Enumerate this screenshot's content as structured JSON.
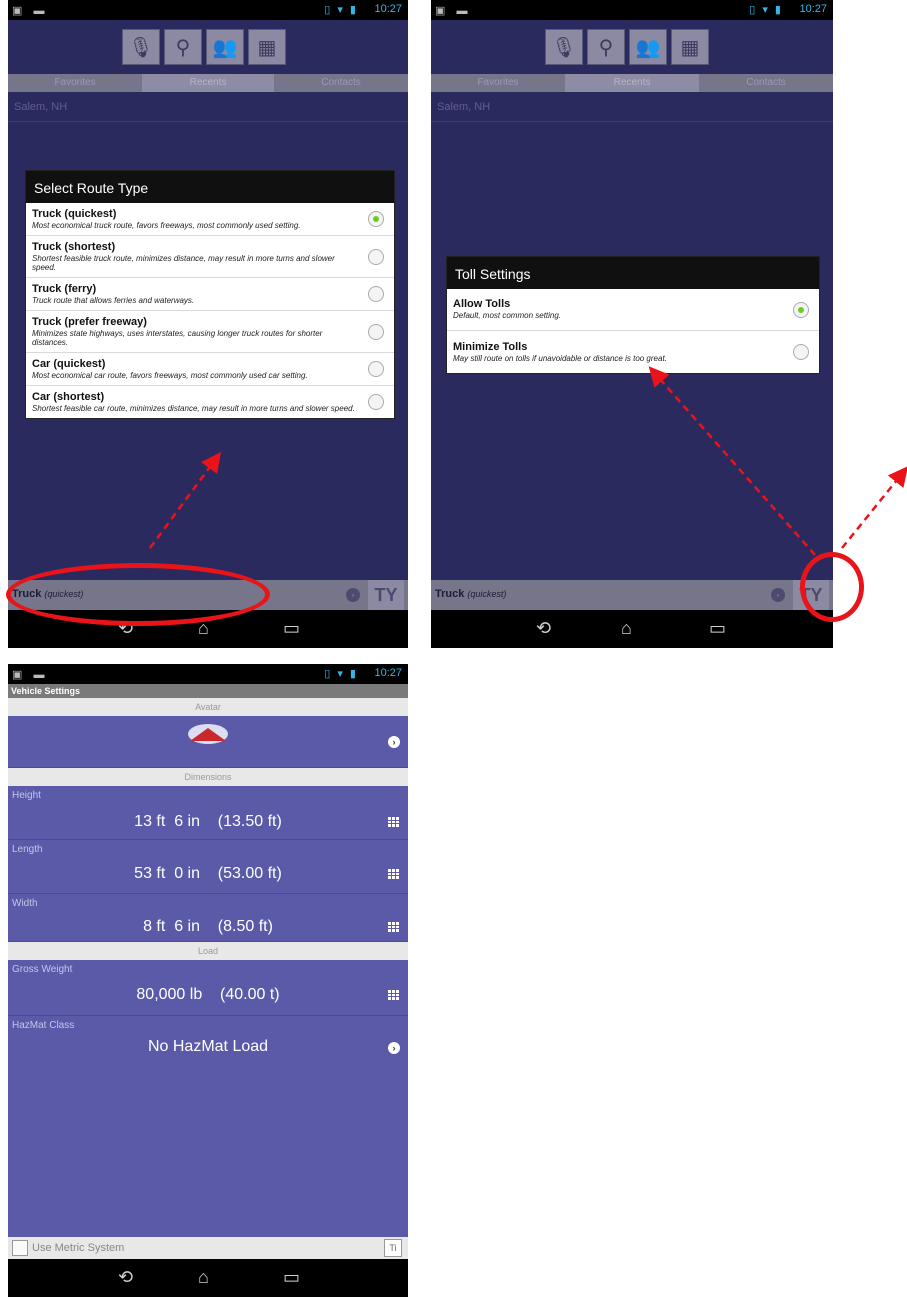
{
  "status_bar": {
    "time": "10:27",
    "left_icons": "▣ ▬",
    "signal": "▯ ▾ ▮"
  },
  "toolbar_icons": [
    "microphone-icon",
    "search-icon",
    "contacts-icon",
    "map-icon"
  ],
  "tabs": [
    "Favorites",
    "Recents",
    "Contacts"
  ],
  "recent_item": "Salem, NH",
  "bottom_bar": {
    "vehicle": "Truck",
    "mode": "(quickest)",
    "dropdown": "◦",
    "wrench": "TY"
  },
  "route_dialog": {
    "title": "Select Route Type",
    "items": [
      {
        "title": "Truck (quickest)",
        "desc": "Most economical truck route, favors freeways, most commonly used setting.",
        "selected": true
      },
      {
        "title": "Truck (shortest)",
        "desc": "Shortest feasible truck route, minimizes distance, may result in more turns and slower speed.",
        "selected": false
      },
      {
        "title": "Truck (ferry)",
        "desc": "Truck route that allows ferries and waterways.",
        "selected": false
      },
      {
        "title": "Truck (prefer freeway)",
        "desc": "Minimizes state highways, uses interstates, causing longer truck routes for shorter distances.",
        "selected": false
      },
      {
        "title": "Car (quickest)",
        "desc": "Most economical car route, favors freeways, most commonly used car setting.",
        "selected": false
      },
      {
        "title": "Car (shortest)",
        "desc": "Shortest feasible car route, minimizes distance, may result in more turns and slower speed.",
        "selected": false
      }
    ]
  },
  "toll_dialog": {
    "title": "Toll Settings",
    "items": [
      {
        "title": "Allow Tolls",
        "desc": "Default, most common setting.",
        "selected": true
      },
      {
        "title": "Minimize Tolls",
        "desc": "May still route on tolls if unavoidable or distance is too great.",
        "selected": false
      }
    ]
  },
  "nav_icons": [
    "back-icon",
    "home-icon",
    "recents-icon"
  ],
  "vehicle_settings": {
    "title": "Vehicle Settings",
    "sections": {
      "avatar": "Avatar",
      "dimensions": "Dimensions",
      "load": "Load"
    },
    "rows": {
      "height": {
        "label": "Height",
        "value": "13 ft  6 in    (13.50 ft)"
      },
      "length": {
        "label": "Length",
        "value": "53 ft  0 in    (53.00 ft)"
      },
      "width": {
        "label": "Width",
        "value": "8 ft  6 in    (8.50 ft)"
      },
      "gross_weight": {
        "label": "Gross Weight",
        "value": "80,000 lb    (40.00 t)"
      },
      "hazmat": {
        "label": "HazMat Class",
        "value": "No HazMat Load"
      }
    },
    "footer": {
      "metric_label": "Use Metric System",
      "info_button": "Ti"
    }
  },
  "colors": {
    "accent_red": "#e8141a",
    "panel_bg": "#2b2a5e",
    "settings_bg": "#5a5aa9",
    "radio_green": "#6dcc1c"
  }
}
